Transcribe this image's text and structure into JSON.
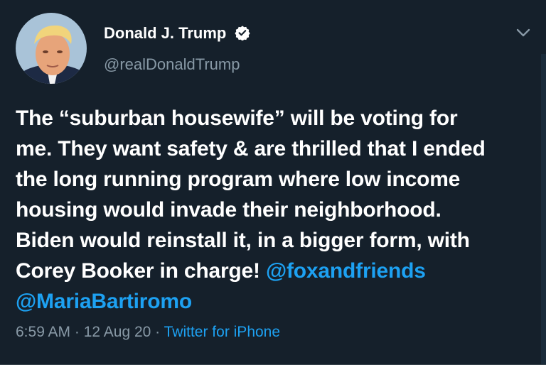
{
  "user": {
    "display_name": "Donald J. Trump",
    "handle": "@realDonaldTrump",
    "verified": true
  },
  "tweet": {
    "lines": [
      "The “suburban housewife” will be voting for",
      "me. They want safety & are thrilled that I ended",
      "the long running program where low income",
      "housing would invade their neighborhood.",
      "Biden would reinstall it, in a bigger form, with",
      "Corey Booker in charge! "
    ],
    "mention_1": "@foxandfriends",
    "mention_2": "@MariaBartiromo"
  },
  "meta": {
    "time": "6:59 AM",
    "separator": " · ",
    "date": "12 Aug 20",
    "source": "Twitter for iPhone"
  },
  "icons": {
    "verified": "verified-badge-icon",
    "menu": "chevron-down-icon"
  },
  "colors": {
    "background": "#15202b",
    "link": "#1da1f2",
    "secondary_text": "#8899a6"
  }
}
